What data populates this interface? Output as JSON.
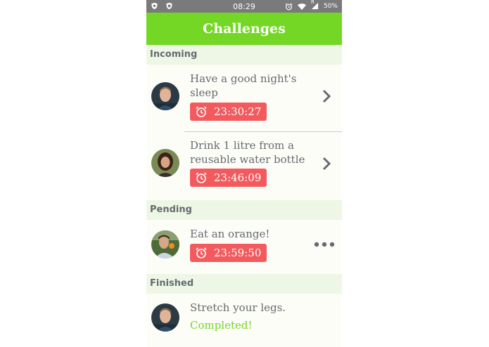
{
  "status_bar": {
    "time": "08:29",
    "battery": "50%",
    "network_indicator": "R"
  },
  "app_bar": {
    "title": "Challenges"
  },
  "sections": {
    "incoming": {
      "label": "Incoming",
      "items": [
        {
          "title": "Have a good night's sleep",
          "timer": "23:30:27"
        },
        {
          "title": "Drink 1 litre from a reusable water bottle",
          "timer": "23:46:09"
        }
      ]
    },
    "pending": {
      "label": "Pending",
      "items": [
        {
          "title": "Eat an orange!",
          "timer": "23:59:50"
        }
      ]
    },
    "finished": {
      "label": "Finished",
      "items": [
        {
          "title": "Stretch your legs.",
          "status": "Completed!"
        }
      ]
    }
  },
  "colors": {
    "accent": "#74d725",
    "timer_badge": "#f25a5e",
    "section_bg": "#eef7e5",
    "text": "#666b70"
  },
  "icons": [
    "shield-icon",
    "shield-b-icon",
    "alarm-icon",
    "wifi-icon",
    "signal-icon",
    "battery-icon",
    "alarm-clock-icon",
    "chevron-right-icon",
    "more-icon"
  ]
}
